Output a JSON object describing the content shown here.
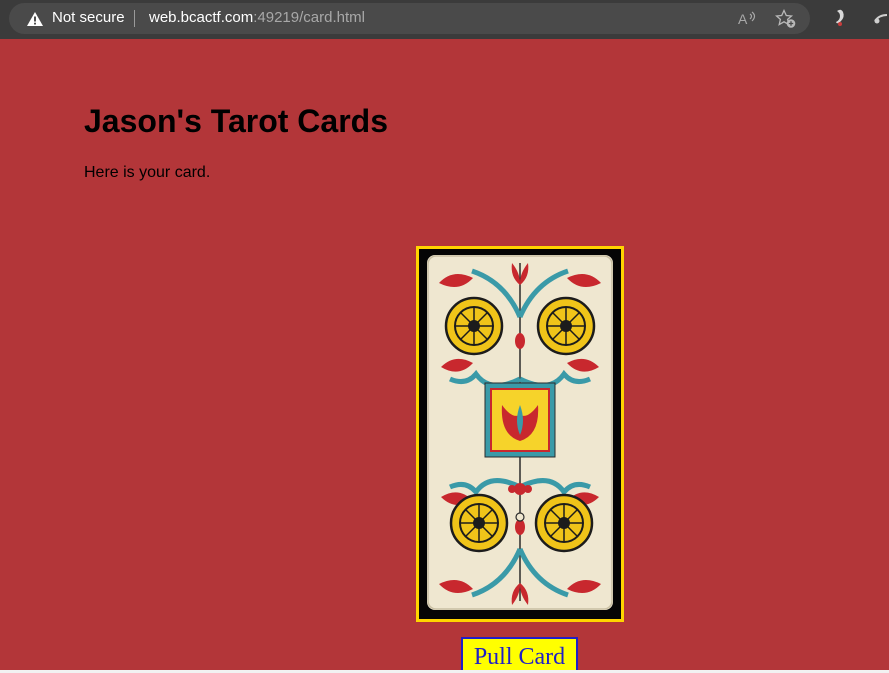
{
  "browser": {
    "security_label": "Not secure",
    "url_host": "web.bcactf.com",
    "url_rest": ":49219/card.html"
  },
  "page": {
    "title": "Jason's Tarot Cards",
    "text": "Here is your card.",
    "button_label": "Pull Card"
  },
  "card": {
    "suit": "coins",
    "count": 4,
    "frame_color": "#ffd400"
  },
  "colors": {
    "background": "#b33639",
    "button_bg": "#ffff00",
    "button_text": "#1f1fc8"
  }
}
